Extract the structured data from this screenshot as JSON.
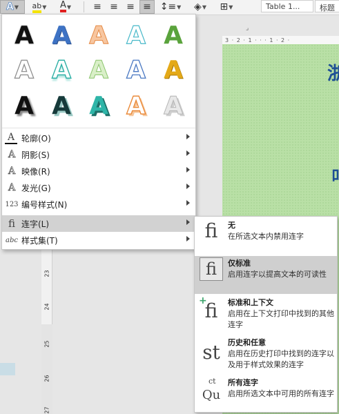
{
  "ribbon": {
    "text_effects_icon": "A",
    "highlight_icon": "ab",
    "font_color_icon": "A",
    "style_box_1": "Table 1...",
    "style_box_2": "标题",
    "colors": {
      "highlight": "#f5e400",
      "font_color": "#e02020",
      "text_effect": "#2f6fbf"
    }
  },
  "document": {
    "ruler_text": "3 · 2 · 1 · · · 1 · 2 ·",
    "heading_1": "浙",
    "heading_2": "叫",
    "vertical_ruler_numbers": [
      "23",
      "24",
      "25",
      "26",
      "27"
    ]
  },
  "text_effects_menu": {
    "gallery": [
      {
        "name": "black-solid",
        "glyph": "A"
      },
      {
        "name": "blue-gradient",
        "glyph": "A"
      },
      {
        "name": "orange-outline",
        "glyph": "A"
      },
      {
        "name": "light-blue-outline",
        "glyph": "A"
      },
      {
        "name": "green-solid",
        "glyph": "A"
      },
      {
        "name": "gray-outline",
        "glyph": "A"
      },
      {
        "name": "teal-reflection",
        "glyph": "A"
      },
      {
        "name": "light-green-outline",
        "glyph": "A"
      },
      {
        "name": "blue-outline",
        "glyph": "A"
      },
      {
        "name": "gold-bevel",
        "glyph": "A"
      },
      {
        "name": "black-shadow",
        "glyph": "A"
      },
      {
        "name": "dark-teal-shadow",
        "glyph": "A"
      },
      {
        "name": "teal-shadow",
        "glyph": "A"
      },
      {
        "name": "orange-shadow",
        "glyph": "A"
      },
      {
        "name": "silver-shadow",
        "glyph": "A"
      }
    ],
    "items": [
      {
        "id": "outline",
        "icon": "A",
        "label": "轮廓(O)"
      },
      {
        "id": "shadow",
        "icon": "A",
        "label": "阴影(S)"
      },
      {
        "id": "reflection",
        "icon": "A",
        "label": "映像(R)"
      },
      {
        "id": "glow",
        "icon": "A",
        "label": "发光(G)"
      },
      {
        "id": "number-style",
        "icon": "123",
        "label": "编号样式(N)"
      },
      {
        "id": "ligatures",
        "icon": "fi",
        "label": "连字(L)"
      },
      {
        "id": "stylistic-sets",
        "icon": "abc",
        "label": "样式集(T)"
      }
    ]
  },
  "ligatures_submenu": {
    "items": [
      {
        "icon": "fi",
        "title": "无",
        "desc": "在所选文本内禁用连字"
      },
      {
        "icon": "fi",
        "title": "仅标准",
        "desc": "启用连字以提高文本的可读性"
      },
      {
        "icon": "fi",
        "title": "标准和上下文",
        "desc": "启用在上下文打印中找到的其他连字"
      },
      {
        "icon": "st",
        "title": "历史和任意",
        "desc": "启用在历史打印中找到的连字以及用于样式效果的连字"
      },
      {
        "icon": "Qu",
        "title": "所有连字",
        "desc": "启用所选文本中可用的所有连字"
      }
    ]
  }
}
